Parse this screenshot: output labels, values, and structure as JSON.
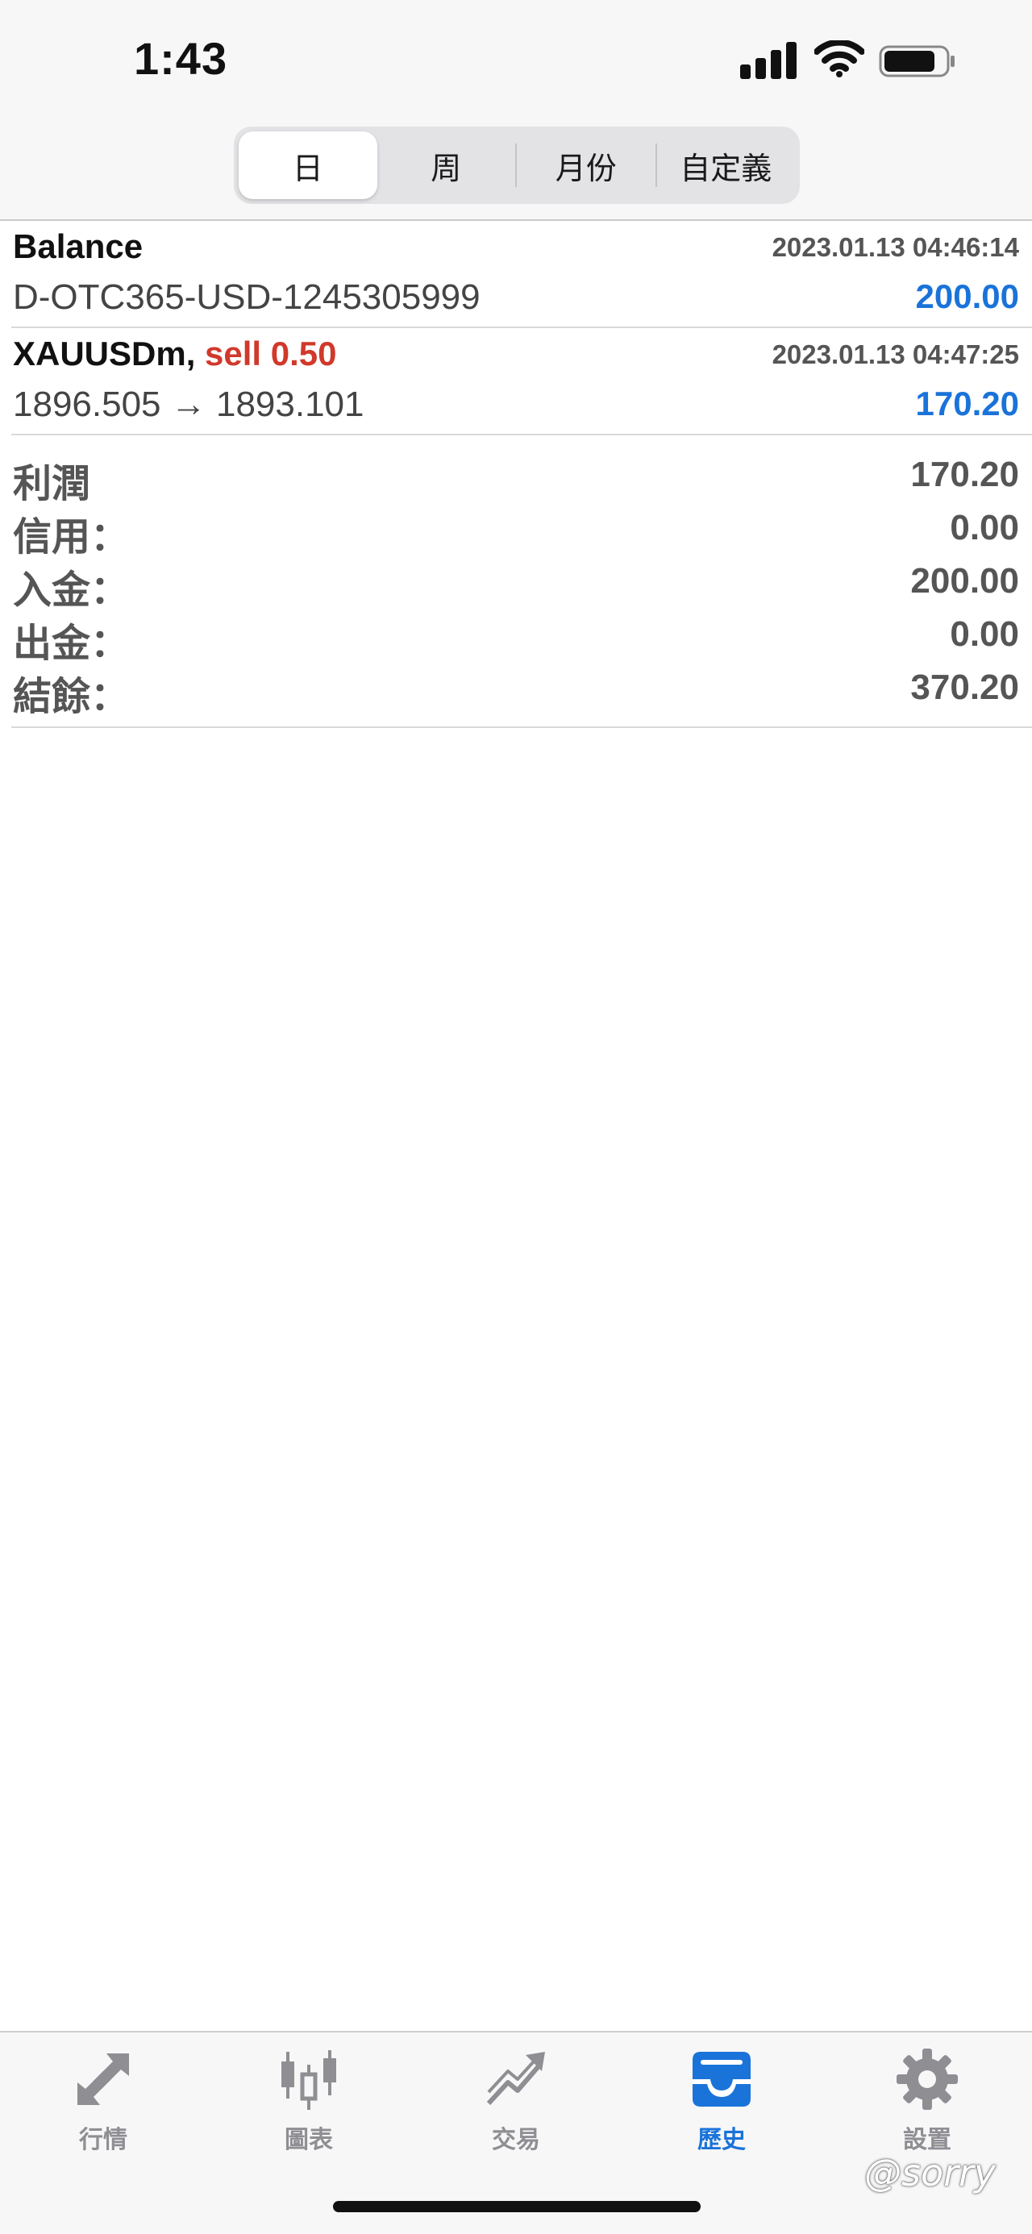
{
  "status_bar": {
    "time": "1:43"
  },
  "segmented": {
    "segments": [
      {
        "label": "日",
        "active": true
      },
      {
        "label": "周",
        "active": false
      },
      {
        "label": "月份",
        "active": false
      },
      {
        "label": "自定義",
        "active": false
      }
    ]
  },
  "history": [
    {
      "title": "Balance",
      "action": "",
      "date": "2023.01.13 04:46:14",
      "subtitle": "D-OTC365-USD-1245305999",
      "amount": "200.00"
    },
    {
      "title": "XAUUSDm,",
      "action": "sell 0.50",
      "date": "2023.01.13 04:47:25",
      "subtitle": "1896.505 → 1893.101",
      "amount": "170.20"
    }
  ],
  "summary": [
    {
      "label": "利潤",
      "value": "170.20"
    },
    {
      "label": "信用：",
      "value": "0.00"
    },
    {
      "label": "入金：",
      "value": "200.00"
    },
    {
      "label": "出金：",
      "value": "0.00"
    },
    {
      "label": "結餘：",
      "value": "370.20"
    }
  ],
  "tabbar": {
    "tabs": [
      {
        "label": "行情",
        "icon": "quotes-arrows-icon",
        "active": false
      },
      {
        "label": "圖表",
        "icon": "candlestick-chart-icon",
        "active": false
      },
      {
        "label": "交易",
        "icon": "trade-chart-icon",
        "active": false
      },
      {
        "label": "歷史",
        "icon": "history-inbox-icon",
        "active": true
      },
      {
        "label": "設置",
        "icon": "gear-icon",
        "active": false
      }
    ]
  },
  "watermark": "@sorry",
  "colors": {
    "accent": "#1a73d9",
    "sell": "#d0392b",
    "inactive": "#8e8e93"
  }
}
